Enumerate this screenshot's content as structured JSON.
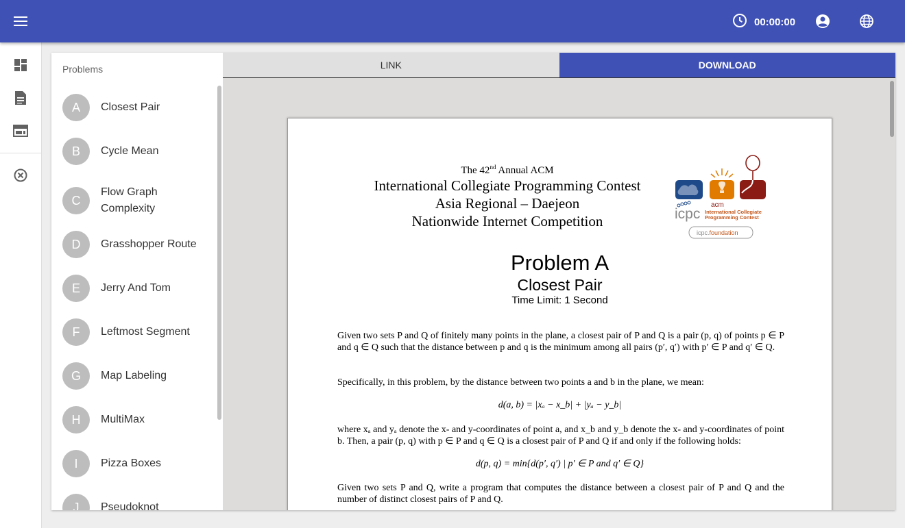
{
  "topbar": {
    "timer": "00:00:00"
  },
  "icons": {
    "menu": "menu-icon",
    "clock": "clock-icon",
    "account": "account-circle-icon",
    "language": "globe-icon",
    "dashboard": "dashboard-icon",
    "description": "document-icon",
    "scoreboard": "web-icon",
    "close": "close-circle-icon"
  },
  "colors": {
    "primary": "#3f51b5",
    "avatar": "#bdbdbd"
  },
  "problems": {
    "header": "Problems",
    "items": [
      {
        "letter": "A",
        "title": "Closest Pair"
      },
      {
        "letter": "B",
        "title": "Cycle Mean"
      },
      {
        "letter": "C",
        "title": "Flow Graph Complexity"
      },
      {
        "letter": "D",
        "title": "Grasshopper Route"
      },
      {
        "letter": "E",
        "title": "Jerry And Tom"
      },
      {
        "letter": "F",
        "title": "Leftmost Segment"
      },
      {
        "letter": "G",
        "title": "Map Labeling"
      },
      {
        "letter": "H",
        "title": "MultiMax"
      },
      {
        "letter": "I",
        "title": "Pizza Boxes"
      },
      {
        "letter": "J",
        "title": "Pseudoknot"
      }
    ]
  },
  "tabs": {
    "link": "LINK",
    "download": "DOWNLOAD"
  },
  "document": {
    "header_line0_pre": "The 42",
    "header_line0_sup": "nd",
    "header_line0_post": " Annual ACM",
    "header_line1": "International Collegiate Programming Contest",
    "header_line2": "Asia Regional – Daejeon",
    "header_line3": "Nationwide Internet Competition",
    "logo_acm": "acm",
    "logo_icpc": "icpc",
    "logo_text1": "International Collegiate",
    "logo_text2": "Programming Contest",
    "logo_foundation_pre": "icpc.",
    "logo_foundation_post": "foundation",
    "problem_label": "Problem A",
    "problem_title": "Closest Pair",
    "time_limit": "Time Limit: 1 Second",
    "para1": "Given two sets P and Q of finitely many points in the plane, a closest pair of P and Q is a pair (p, q) of points p ∈ P and q ∈ Q such that the distance between p and q is the minimum among all pairs (p′, q′) with p′ ∈ P and q′ ∈ Q.",
    "para2": "Specifically, in this problem, by the distance between two points a and b in the plane, we mean:",
    "formula1": "d(a, b) = |xₐ − x_b| + |yₐ − y_b|",
    "para3": "where xₐ and yₐ denote the x- and y-coordinates of point a, and x_b and y_b denote the x- and y-coordinates of point b. Then, a pair (p, q) with p ∈ P and q ∈ Q is a closest pair of P and Q if and only if the following holds:",
    "formula2": "d(p, q) = min{d(p′, q′) | p′ ∈ P and q′ ∈ Q}",
    "para4": "Given two sets P and Q, write a program that computes the distance between a closest pair of P and Q and the number of distinct closest pairs of P and Q."
  }
}
